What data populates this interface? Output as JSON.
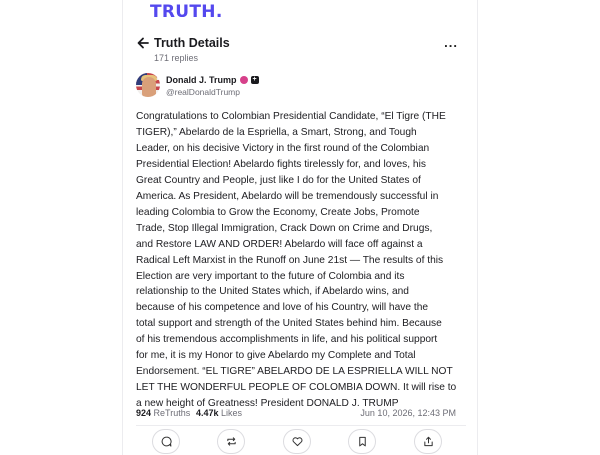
{
  "app": {
    "logo": "TRUTH."
  },
  "header": {
    "title": "Truth Details",
    "replies": "171 replies",
    "more": "..."
  },
  "author": {
    "name": "Donald J. Trump",
    "handle": "@realDonaldTrump"
  },
  "post": {
    "lines": [
      "Congratulations to Colombian Presidential Candidate, “El Tigre (THE",
      "TIGER),” Abelardo de la Espriella, a Smart, Strong, and Tough",
      "Leader, on his decisive Victory in the first round of the Colombian",
      "Presidential Election! Abelardo fights tirelessly for, and loves, his",
      "Great Country and People, just like I do for the United States of",
      "America. As President, Abelardo will be tremendously successful in",
      "leading Colombia to Grow the Economy, Create Jobs, Promote",
      "Trade, Stop Illegal Immigration, Crack Down on Crime and Drugs,",
      "and Restore LAW AND ORDER! Abelardo will face off against a",
      "Radical Left Marxist in the Runoff on June 21st — The results of this",
      "Election are very important to the future of Colombia and its",
      "relationship to the United States which, if Abelardo wins, and",
      "because of his competence and love of his Country, will have the",
      "total support and strength of the United States behind him. Because",
      "of his tremendous accomplishments in life, and his political support",
      "for me, it is my Honor to give Abelardo my Complete and Total",
      "Endorsement. “EL TIGRE” ABELARDO DE LA ESPRIELLA WILL NOT",
      "LET THE WONDERFUL PEOPLE OF COLOMBIA DOWN. It will rise to",
      "a new height of Greatness! President DONALD J. TRUMP"
    ]
  },
  "stats": {
    "retruths_count": "924",
    "retruths_label": "ReTruths",
    "likes_count": "4.47k",
    "likes_label": "Likes",
    "date": "Jun 10, 2026, 12:43 PM"
  },
  "actions": [
    "reply-icon",
    "retruth-icon",
    "like-icon",
    "bookmark-icon",
    "share-icon"
  ],
  "colors": {
    "brand": "#5448EE",
    "verified": "#D6408A"
  }
}
